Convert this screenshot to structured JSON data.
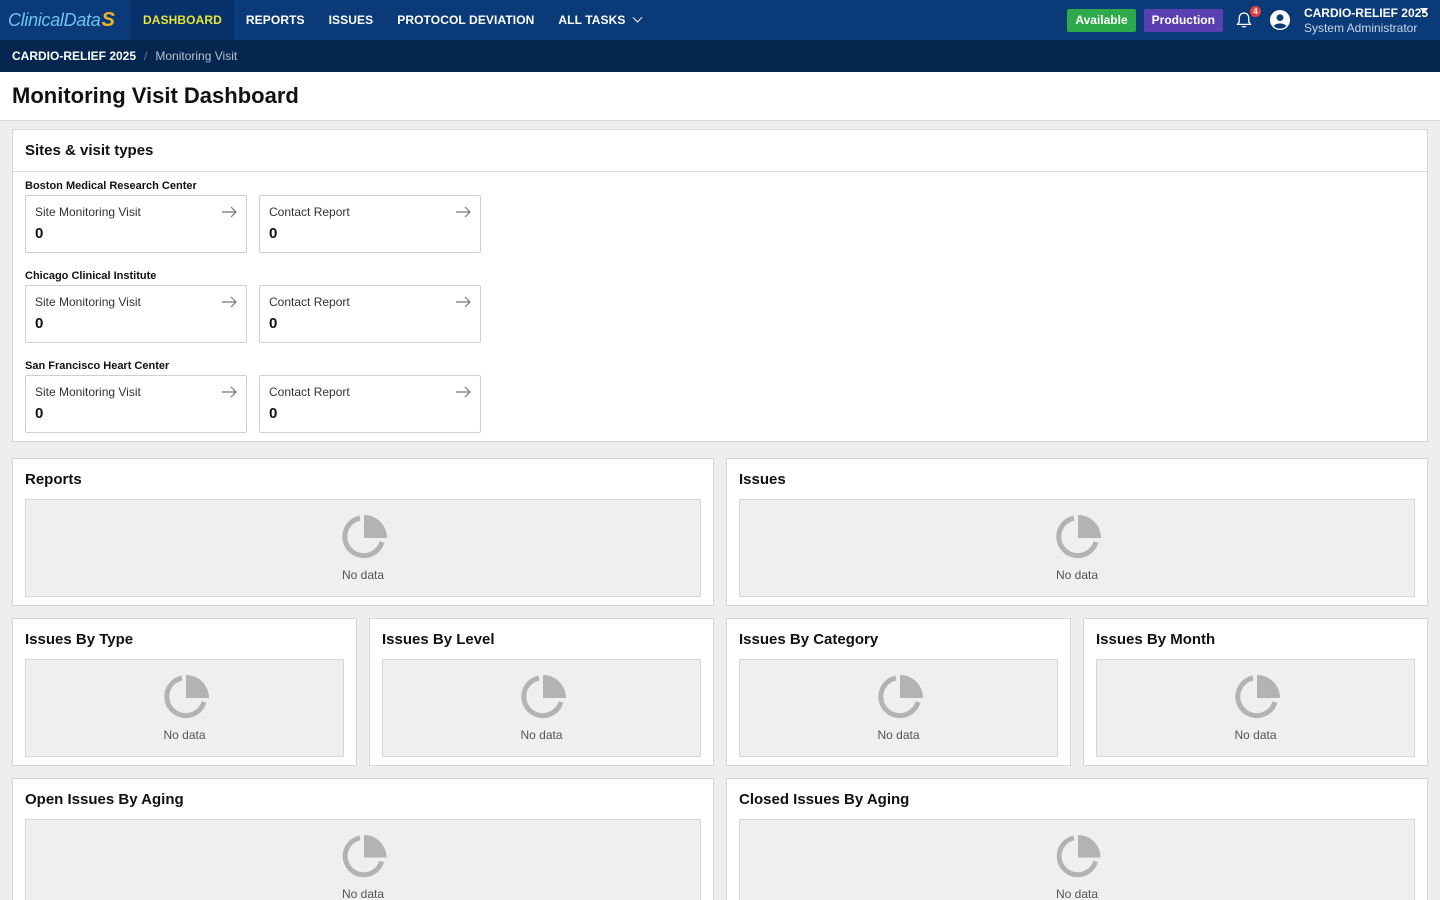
{
  "logo": {
    "text": "ClinicalData",
    "mark": "S"
  },
  "nav": {
    "items": [
      "DASHBOARD",
      "REPORTS",
      "ISSUES",
      "PROTOCOL DEVIATION",
      "ALL TASKS"
    ],
    "active": "DASHBOARD"
  },
  "status": {
    "available": "Available",
    "environment": "Production"
  },
  "notifications": {
    "count": "4"
  },
  "user": {
    "study": "CARDIO-RELIEF 2025",
    "role": "System Administrator"
  },
  "breadcrumb": {
    "root": "CARDIO-RELIEF 2025",
    "separator": "/",
    "current": "Monitoring Visit"
  },
  "page": {
    "title": "Monitoring Visit Dashboard"
  },
  "sites_panel": {
    "title": "Sites & visit types",
    "sites": [
      {
        "name": "Boston Medical Research Center",
        "visits": [
          {
            "label": "Site Monitoring Visit",
            "count": "0"
          },
          {
            "label": "Contact Report",
            "count": "0"
          }
        ]
      },
      {
        "name": "Chicago Clinical Institute",
        "visits": [
          {
            "label": "Site Monitoring Visit",
            "count": "0"
          },
          {
            "label": "Contact Report",
            "count": "0"
          }
        ]
      },
      {
        "name": "San Francisco Heart Center",
        "visits": [
          {
            "label": "Site Monitoring Visit",
            "count": "0"
          },
          {
            "label": "Contact Report",
            "count": "0"
          }
        ]
      }
    ]
  },
  "charts": {
    "reports": {
      "title": "Reports",
      "empty": "No data"
    },
    "issues": {
      "title": "Issues",
      "empty": "No data"
    },
    "by_type": {
      "title": "Issues By Type",
      "empty": "No data"
    },
    "by_level": {
      "title": "Issues By Level",
      "empty": "No data"
    },
    "by_category": {
      "title": "Issues By Category",
      "empty": "No data"
    },
    "by_month": {
      "title": "Issues By Month",
      "empty": "No data"
    },
    "open_aging": {
      "title": "Open Issues By Aging",
      "empty": "No data"
    },
    "closed_aging": {
      "title": "Closed Issues By Aging",
      "empty": "No data"
    }
  },
  "colors": {
    "nav": "#0b3a78",
    "breadcrumb": "#05264f",
    "active_nav_text": "#e7e33a",
    "available": "#2eaa4a",
    "production": "#5a3fb0",
    "notification": "#e6413f"
  }
}
